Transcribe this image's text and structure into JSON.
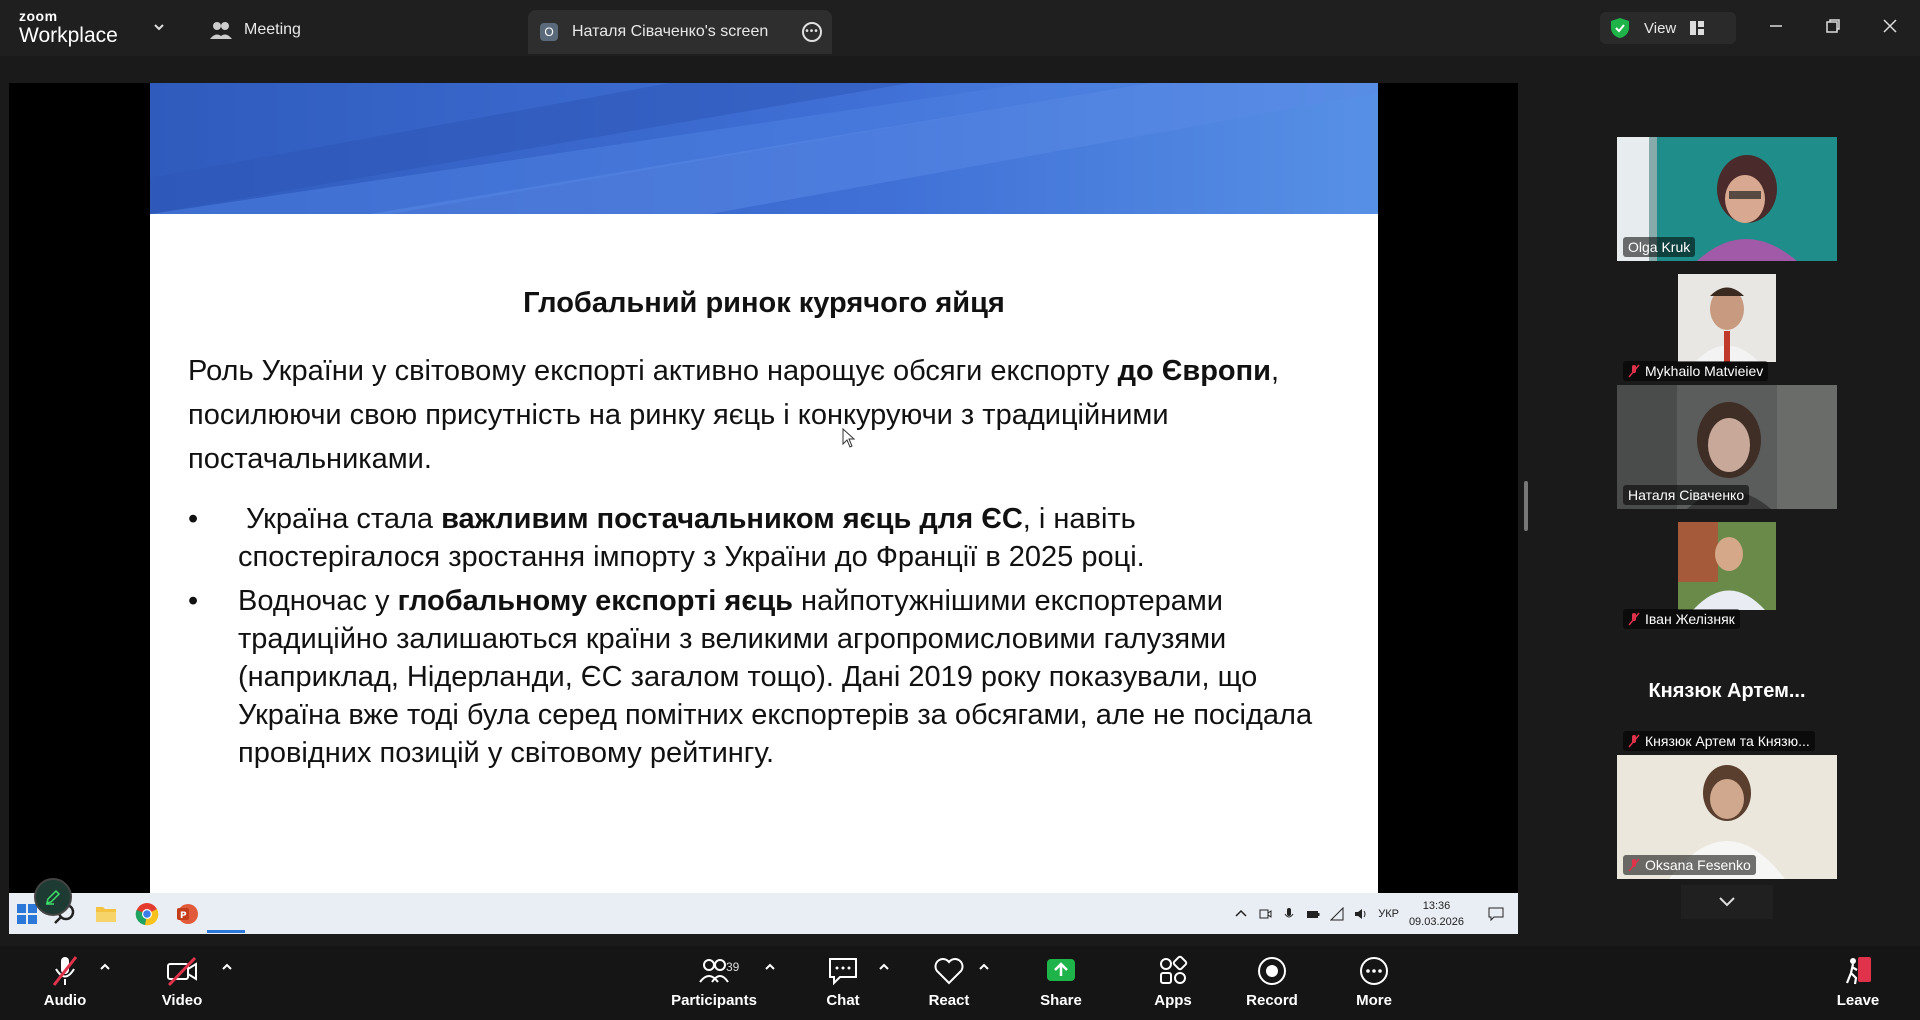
{
  "window": {
    "brand_top": "zoom",
    "brand_bottom": "Workplace",
    "meeting_tab": "Meeting",
    "screen_tab_badge": "O",
    "screen_tab": "Наталя Сіваченко's screen",
    "view_label": "View"
  },
  "slide": {
    "title": "Глобальний ринок курячого яйця",
    "para_pre": "Роль України у світовому експорті активно нарощує обсяги експорту ",
    "para_bold": "до Європи",
    "para_post": ", посилюючи свою присутність на ринку яєць і конкуруючи з традиційними постачальниками.",
    "bullet_marker": "•",
    "b1_pre": " Україна стала ",
    "b1_bold": "важливим постачальником яєць для ЄС",
    "b1_post": ", і навіть спостерігалося зростання імпорту з України до Франції в 2025 році.",
    "b2_pre": "Водночас у ",
    "b2_bold": "глобальному експорті яєць",
    "b2_post": " найпотужнішими експортерами традиційно залишаються країни з великими агропромисловими галузями (наприклад, Нідерланди, ЄС загалом тощо). Дані 2019 року показували, що Україна вже тоді була серед помітних експортерів за обсягами, але не посідала провідних позицій у світовому рейтингу."
  },
  "taskbar": {
    "lang": "УКР",
    "time": "13:36",
    "date": "09.03.2026"
  },
  "participants": [
    {
      "name": "Olga Kruk",
      "muted": false
    },
    {
      "name": "Mykhailo Matvieiev",
      "muted": true
    },
    {
      "name": "Наталя Сіваченко",
      "muted": false,
      "speaking": true
    },
    {
      "name": "Іван Желізняк",
      "muted": true
    },
    {
      "name": "Князюк  Артем...",
      "video": false
    },
    {
      "name": "Князюк Артем та Князю...",
      "muted": true
    },
    {
      "name": "Oksana  Fesenko",
      "muted": true
    }
  ],
  "toolbar": {
    "audio": "Audio",
    "video": "Video",
    "participants": "Participants",
    "participants_count": "39",
    "chat": "Chat",
    "react": "React",
    "share": "Share",
    "apps": "Apps",
    "record": "Record",
    "more": "More",
    "leave": "Leave"
  },
  "colors": {
    "accent_green": "#3ee06a",
    "share_green": "#1fb449",
    "leave_red": "#e0334b",
    "slide_blue": "#4a7fdd"
  }
}
